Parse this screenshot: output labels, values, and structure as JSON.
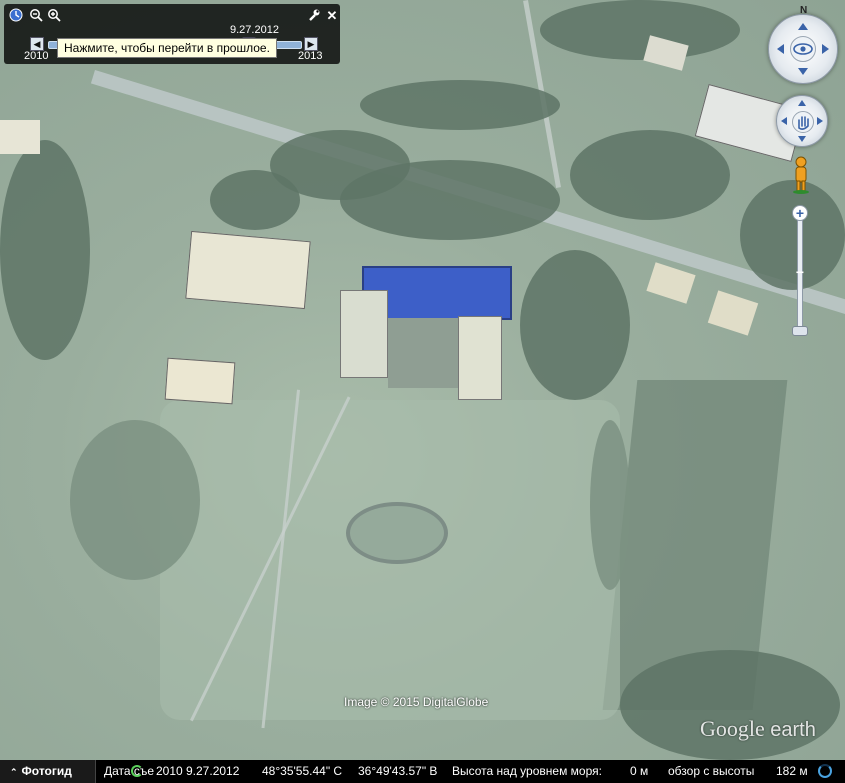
{
  "time_slider": {
    "current_date": "9.27.2012",
    "start_year": "2010",
    "end_year": "2013",
    "tooltip": "Нажмите, чтобы перейти в прошлое.",
    "step_back_label": "◀",
    "step_forward_label": "▶"
  },
  "navigation": {
    "compass_north": "N",
    "zoom_in_label": "+",
    "zoom_out_label": "−"
  },
  "map": {
    "imagery_credit": "Image © 2015 DigitalGlobe",
    "logo_google": "Google",
    "logo_earth": "earth"
  },
  "status_bar": {
    "tour_guide": "Фотогид",
    "imagery_date_label": "Дата съе",
    "imagery_date_year": "2010",
    "imagery_date": "9.27.2012",
    "latitude": "48°35'55.44\" С",
    "longitude": "36°49'43.57\" В",
    "elevation_label": "Высота над уровнем моря:",
    "elevation_value": "0 м",
    "eye_alt_label": "обзор с высоты",
    "eye_alt_value": "182 м"
  },
  "colors": {
    "panel_bg": "#000000",
    "slider_track": "#8fb2d8",
    "tooltip_bg": "#ffffe1",
    "roof_blue": "#3d5fc8"
  }
}
